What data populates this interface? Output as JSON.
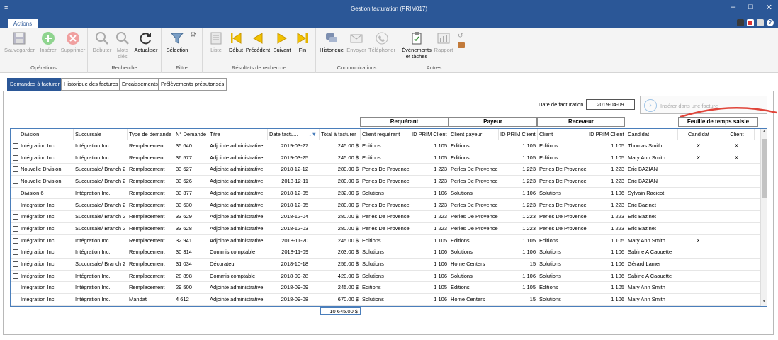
{
  "window": {
    "title": "Gestion facturation (PRIM017)"
  },
  "ribbon_tab": {
    "label": "Actions"
  },
  "ribbon": {
    "groups": [
      {
        "label": "Opérations",
        "buttons": [
          "Sauvegarder",
          "Insérer",
          "Supprimer"
        ]
      },
      {
        "label": "Recherche",
        "buttons": [
          "Débuter",
          "Mots clés",
          "Actualiser"
        ]
      },
      {
        "label": "Filtre",
        "buttons": [
          "Sélection"
        ]
      },
      {
        "label": "Résultats de recherche",
        "buttons": [
          "Liste",
          "Début",
          "Précédent",
          "Suivant",
          "Fin"
        ]
      },
      {
        "label": "Communications",
        "buttons": [
          "Historique",
          "Envoyer",
          "Téléphoner"
        ]
      },
      {
        "label": "Autres",
        "buttons": [
          "Événements et tâches",
          "Rapport"
        ]
      }
    ]
  },
  "subtabs": [
    "Demandes à facturer",
    "Historique des factures",
    "Encaissements",
    "Prélèvements préautorisés"
  ],
  "date_label": "Date de facturation",
  "date_value": "2019-04-09",
  "insert_label": "Insérer dans une facture",
  "group_headers": [
    "Requérant",
    "Payeur",
    "Receveur",
    "Feuille de temps saisie"
  ],
  "columns": [
    "Division",
    "Succursale",
    "Type de demande",
    "N° Demande",
    "Titre",
    "Date factu...",
    "Total à facturer",
    "Client requérant",
    "ID PRIM Client",
    "Client payeur",
    "ID PRIM Client",
    "Client",
    "ID PRIM Client",
    "Candidat",
    "Candidat",
    "Client"
  ],
  "rows": [
    [
      "Intégration Inc.",
      "Intégration Inc.",
      "Remplacement",
      "35 640",
      "Adjointe administrative",
      "2019-03-27",
      "245.00 $",
      "Editions",
      "1 105",
      "Editions",
      "1 105",
      "Editions",
      "1 105",
      "Thomas Smith",
      "X",
      "X"
    ],
    [
      "Intégration Inc.",
      "Intégration Inc.",
      "Remplacement",
      "36 577",
      "Adjointe administrative",
      "2019-03-25",
      "245.00 $",
      "Editions",
      "1 105",
      "Editions",
      "1 105",
      "Editions",
      "1 105",
      "Mary Ann Smith",
      "X",
      "X"
    ],
    [
      "Nouvelle Division",
      "Succursale/ Branch 2",
      "Remplacement",
      "33 627",
      "Adjointe administrative",
      "2018-12-12",
      "280.00 $",
      "Perles De Provence",
      "1 223",
      "Perles De Provence",
      "1 223",
      "Perles De Provence",
      "1 223",
      "Eric BAZIAN",
      "",
      ""
    ],
    [
      "Nouvelle Division",
      "Succursale/ Branch 2",
      "Remplacement",
      "33 626",
      "Adjointe administrative",
      "2018-12-11",
      "280.00 $",
      "Perles De Provence",
      "1 223",
      "Perles De Provence",
      "1 223",
      "Perles De Provence",
      "1 223",
      "Eric BAZIAN",
      "",
      ""
    ],
    [
      "Division 6",
      "Intégration Inc.",
      "Remplacement",
      "33 377",
      "Adjointe administrative",
      "2018-12-05",
      "232.00 $",
      "Solutions",
      "1 106",
      "Solutions",
      "1 106",
      "Solutions",
      "1 106",
      "Sylvain Racicot",
      "",
      ""
    ],
    [
      "Intégration Inc.",
      "Succursale/ Branch 2",
      "Remplacement",
      "33 630",
      "Adjointe administrative",
      "2018-12-05",
      "280.00 $",
      "Perles De Provence",
      "1 223",
      "Perles De Provence",
      "1 223",
      "Perles De Provence",
      "1 223",
      "Eric Bazinet",
      "",
      ""
    ],
    [
      "Intégration Inc.",
      "Succursale/ Branch 2",
      "Remplacement",
      "33 629",
      "Adjointe administrative",
      "2018-12-04",
      "280.00 $",
      "Perles De Provence",
      "1 223",
      "Perles De Provence",
      "1 223",
      "Perles De Provence",
      "1 223",
      "Eric Bazinet",
      "",
      ""
    ],
    [
      "Intégration Inc.",
      "Succursale/ Branch 2",
      "Remplacement",
      "33 628",
      "Adjointe administrative",
      "2018-12-03",
      "280.00 $",
      "Perles De Provence",
      "1 223",
      "Perles De Provence",
      "1 223",
      "Perles De Provence",
      "1 223",
      "Eric Bazinet",
      "",
      ""
    ],
    [
      "Intégration Inc.",
      "Intégration Inc.",
      "Remplacement",
      "32 941",
      "Adjointe administrative",
      "2018-11-20",
      "245.00 $",
      "Editions",
      "1 105",
      "Editions",
      "1 105",
      "Editions",
      "1 105",
      "Mary Ann Smith",
      "X",
      ""
    ],
    [
      "Intégration Inc.",
      "Intégration Inc.",
      "Remplacement",
      "30 314",
      "Commis comptable",
      "2018-11-09",
      "203.00 $",
      "Solutions",
      "1 106",
      "Solutions",
      "1 106",
      "Solutions",
      "1 106",
      "Sabine A Caouette",
      "",
      ""
    ],
    [
      "Intégration Inc.",
      "Succursale/ Branch 2",
      "Remplacement",
      "31 034",
      "Décorateur",
      "2018-10-18",
      "256.00 $",
      "Solutions",
      "1 106",
      "Home Centers",
      "15",
      "Solutions",
      "1 106",
      "Gérard Lamer",
      "",
      ""
    ],
    [
      "Intégration Inc.",
      "Intégration Inc.",
      "Remplacement",
      "28 898",
      "Commis comptable",
      "2018-09-28",
      "420.00 $",
      "Solutions",
      "1 106",
      "Solutions",
      "1 106",
      "Solutions",
      "1 106",
      "Sabine A Caouette",
      "",
      ""
    ],
    [
      "Intégration Inc.",
      "Intégration Inc.",
      "Remplacement",
      "29 500",
      "Adjointe administrative",
      "2018-09-09",
      "245.00 $",
      "Editions",
      "1 105",
      "Editions",
      "1 105",
      "Editions",
      "1 105",
      "Mary Ann Smith",
      "",
      ""
    ],
    [
      "Intégration Inc.",
      "Intégration Inc.",
      "Mandat",
      "4 612",
      "Adjointe administrative",
      "2018-09-08",
      "670.00 $",
      "Solutions",
      "1 106",
      "Home Centers",
      "15",
      "Solutions",
      "1 106",
      "Mary Ann Smith",
      "",
      ""
    ]
  ],
  "total": "10 645.00 $",
  "colors": {
    "accent": "#2b5797",
    "grid_border": "#4a7ebb",
    "annotation": "#e0453a",
    "nav_yellow": "#f2c200"
  }
}
